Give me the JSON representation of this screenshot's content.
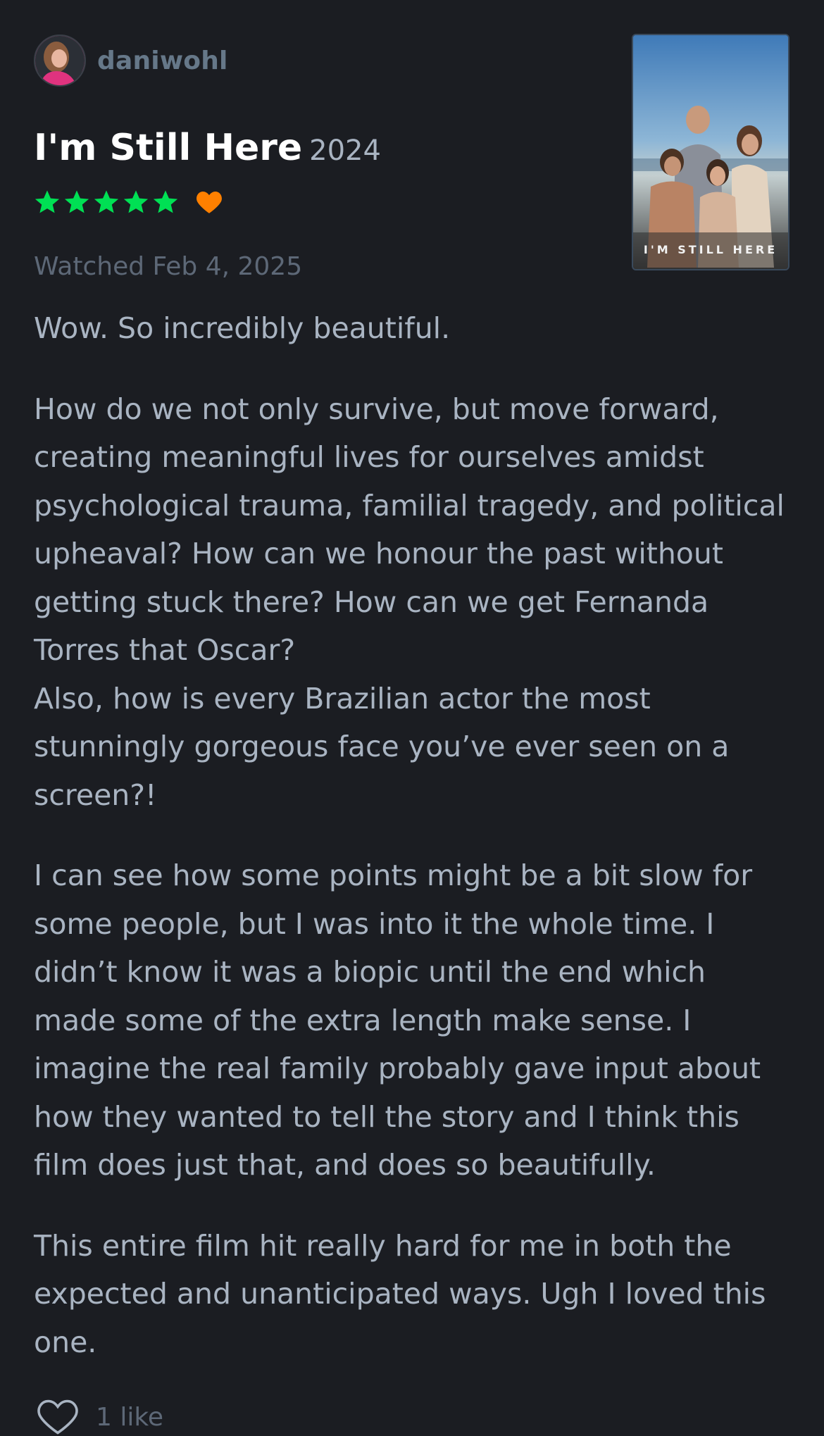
{
  "user": {
    "username": "daniwohl"
  },
  "film": {
    "title": "I'm Still Here",
    "year": "2024",
    "poster_text": "I'M STILL HERE"
  },
  "rating": {
    "stars": 5,
    "max_stars": 5,
    "liked": true
  },
  "watched_text": "Watched Feb 4, 2025",
  "review": {
    "paragraphs": [
      "Wow. So incredibly beautiful.",
      "How do we not only survive, but move forward, creating meaningful lives for ourselves amidst psychological trauma, familial tragedy, and political upheaval? How can we honour the past without getting stuck there? How can we get Fernanda Torres that Oscar?",
      "Also, how is every Brazilian actor the most stunningly gorgeous face you’ve ever seen on a screen?!",
      "I can see how some points might be a bit slow for some people, but I was into it the whole time. I didn’t know it was a biopic until the end which made some of the extra length make sense. I imagine the real family probably gave input about how they wanted to tell the story and I think this film does just that, and does so beautifully.",
      "This entire film hit really hard for me in both the expected and unanticipated ways. Ugh I loved this one."
    ]
  },
  "likes": {
    "label": "1 like"
  },
  "colors": {
    "background": "#1b1d22",
    "star": "#00e054",
    "heart": "#ff8000",
    "username": "#667889",
    "body_text": "#a9b4c2",
    "muted_text": "#5d6877"
  },
  "icons": {
    "avatar": "user-avatar",
    "star": "star-icon",
    "liked": "heart-filled-icon",
    "like_button": "heart-outline-icon"
  }
}
